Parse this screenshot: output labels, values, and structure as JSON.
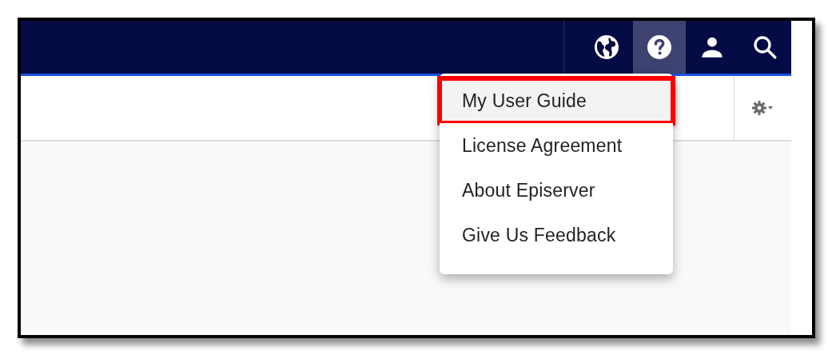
{
  "nav_buttons": [
    {
      "kind": "globe",
      "selected": false
    },
    {
      "kind": "help",
      "selected": true
    },
    {
      "kind": "user",
      "selected": false
    },
    {
      "kind": "search",
      "selected": false
    }
  ],
  "help_menu": {
    "items": [
      {
        "label": "My User Guide",
        "selected": true,
        "callout": true
      },
      {
        "label": "License Agreement",
        "selected": false,
        "callout": false
      },
      {
        "label": "About Episerver",
        "selected": false,
        "callout": false
      },
      {
        "label": "Give Us Feedback",
        "selected": false,
        "callout": false
      }
    ]
  }
}
